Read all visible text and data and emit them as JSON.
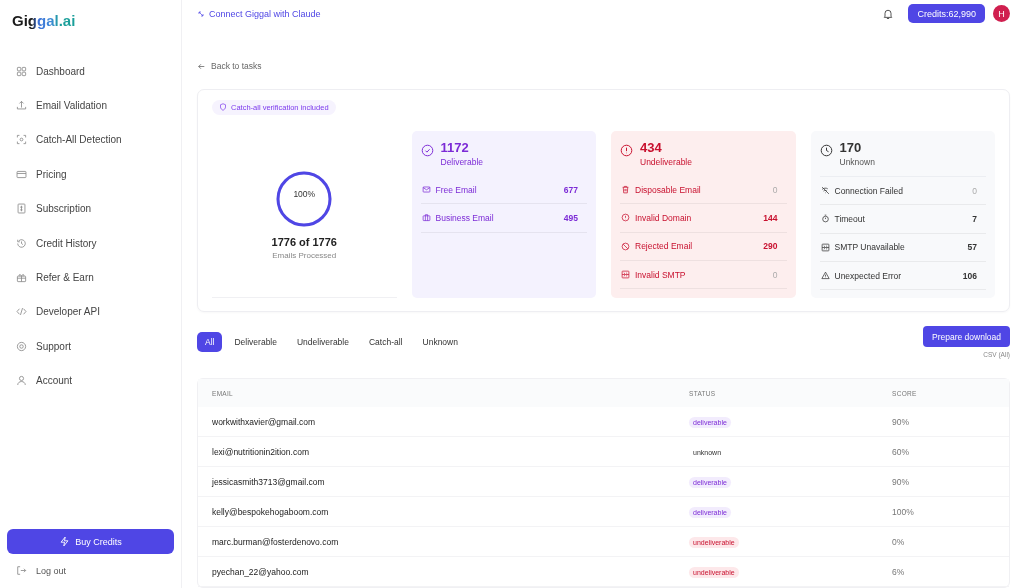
{
  "logo": "Giggal.ai",
  "sidebar": {
    "items": [
      {
        "label": "Dashboard",
        "selected": false
      },
      {
        "label": "Email Validation",
        "selected": false
      },
      {
        "label": "Catch-All Detection",
        "selected": false
      },
      {
        "label": "Pricing",
        "selected": false
      },
      {
        "label": "Subscription",
        "selected": false
      },
      {
        "label": "Credit History",
        "selected": false
      },
      {
        "label": "Refer & Earn",
        "selected": false
      },
      {
        "label": "Developer API",
        "selected": false
      },
      {
        "label": "Support",
        "selected": false
      },
      {
        "label": "Account",
        "selected": false
      }
    ],
    "buy_button": "Buy Credits",
    "logout": "Log out"
  },
  "topbar": {
    "link": "Connect Giggal with Claude",
    "credits": "Credits:62,990",
    "avatar": "H"
  },
  "back_link": "Back to tasks",
  "summary": {
    "badge": "Catch-all verification included",
    "progress": {
      "level": 1,
      "percent": "100%",
      "count": "1776 of 1776",
      "caption": "Emails Processed"
    },
    "cards": [
      {
        "kind": "deliverable",
        "count": "1172",
        "label": "Deliverable",
        "items": [
          {
            "label": "Free Email",
            "value": "677",
            "dim": false
          },
          {
            "label": "Business Email",
            "value": "495",
            "dim": false
          }
        ]
      },
      {
        "kind": "undeliverable",
        "count": "434",
        "label": "Undeliverable",
        "items": [
          {
            "label": "Disposable Email",
            "value": "0",
            "dim": true
          },
          {
            "label": "Invalid Domain",
            "value": "144",
            "dim": false
          },
          {
            "label": "Rejected Email",
            "value": "290",
            "dim": false
          },
          {
            "label": "Invalid SMTP",
            "value": "0",
            "dim": true
          }
        ]
      },
      {
        "kind": "unknown",
        "count": "170",
        "label": "Unknown",
        "items": [
          {
            "label": "Connection Failed",
            "value": "0",
            "dim": true
          },
          {
            "label": "Timeout",
            "value": "7",
            "dim": false
          },
          {
            "label": "SMTP Unavailable",
            "value": "57",
            "dim": false
          },
          {
            "label": "Unexpected Error",
            "value": "106",
            "dim": false
          }
        ]
      }
    ]
  },
  "filters": [
    {
      "label": "All",
      "selected": true
    },
    {
      "label": "Deliverable",
      "selected": false
    },
    {
      "label": "Undeliverable",
      "selected": false
    },
    {
      "label": "Catch-all",
      "selected": false
    },
    {
      "label": "Unknown",
      "selected": false
    }
  ],
  "download": {
    "button": "Prepare download",
    "note": "CSV (All)"
  },
  "table": {
    "columns": [
      "EMAIL",
      "STATUS",
      "SCORE"
    ],
    "rows": [
      {
        "email": "workwithxavier@gmail.com",
        "status": "deliverable",
        "kind": "deliverable",
        "score": "90%"
      },
      {
        "email": "lexi@nutritionin2ition.com",
        "status": "unknown",
        "kind": "unknown",
        "score": "60%"
      },
      {
        "email": "jessicasmith3713@gmail.com",
        "status": "deliverable",
        "kind": "deliverable",
        "score": "90%"
      },
      {
        "email": "kelly@bespokehogaboom.com",
        "status": "deliverable",
        "kind": "deliverable",
        "score": "100%"
      },
      {
        "email": "marc.burman@fosterdenovo.com",
        "status": "undeliverable",
        "kind": "undeliverable",
        "score": "0%"
      },
      {
        "email": "pyechan_22@yahoo.com",
        "status": "undeliverable",
        "kind": "undeliverable",
        "score": "6%"
      }
    ]
  }
}
